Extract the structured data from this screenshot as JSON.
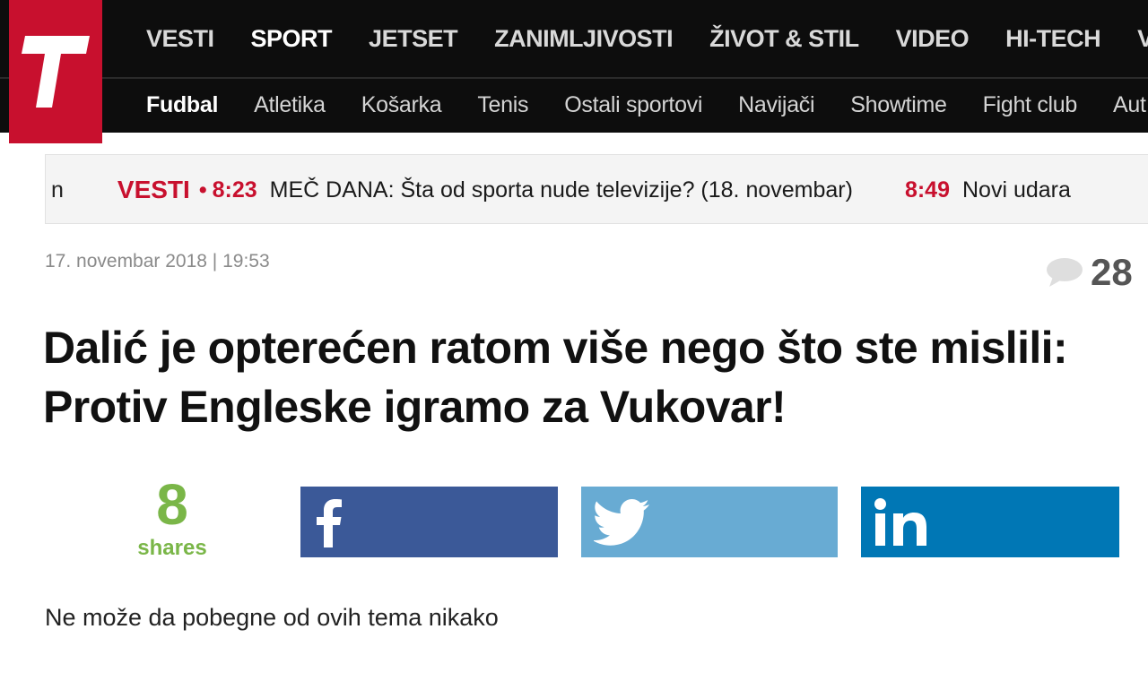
{
  "header": {
    "logo_alt": "T",
    "main_nav": [
      {
        "label": "VESTI",
        "active": false
      },
      {
        "label": "SPORT",
        "active": true
      },
      {
        "label": "JETSET",
        "active": false
      },
      {
        "label": "ZANIMLJIVOSTI",
        "active": false
      },
      {
        "label": "ŽIVOT & STIL",
        "active": false
      },
      {
        "label": "VIDEO",
        "active": false
      },
      {
        "label": "HI-TECH",
        "active": false
      },
      {
        "label": "VIŠ",
        "active": false
      }
    ],
    "sub_nav": [
      {
        "label": "Fudbal",
        "active": true
      },
      {
        "label": "Atletika",
        "active": false
      },
      {
        "label": "Košarka",
        "active": false
      },
      {
        "label": "Tenis",
        "active": false
      },
      {
        "label": "Ostali sportovi",
        "active": false
      },
      {
        "label": "Navijači",
        "active": false
      },
      {
        "label": "Showtime",
        "active": false
      },
      {
        "label": "Fight club",
        "active": false
      },
      {
        "label": "Aut",
        "active": false
      }
    ]
  },
  "ticker": {
    "cut_text": "n",
    "label": "VESTI",
    "items": [
      {
        "time": "8:23",
        "text": "MEČ DANA: Šta od sporta nude televizije? (18. novembar)"
      },
      {
        "time": "8:49",
        "text": "Novi udara"
      }
    ]
  },
  "article": {
    "date": "17. novembar 2018 | 19:53",
    "comment_count": "28",
    "headline_line1": "Dalić je opterećen ratom više nego što ste mislili:",
    "headline_line2": "Protiv Engleske igramo za Vukovar!",
    "shares_count": "8",
    "shares_label": "shares",
    "lead": "Ne može da pobegne od ovih tema nikako"
  },
  "colors": {
    "brand_red": "#c8102e",
    "nav_bg": "#0d0d0d",
    "shares_green": "#7ab648",
    "facebook": "#3b5998",
    "twitter": "#68abd3",
    "linkedin": "#0077b5"
  },
  "icons": [
    "logo-t-icon",
    "comment-bubble-icon",
    "facebook-icon",
    "twitter-icon",
    "linkedin-icon"
  ]
}
